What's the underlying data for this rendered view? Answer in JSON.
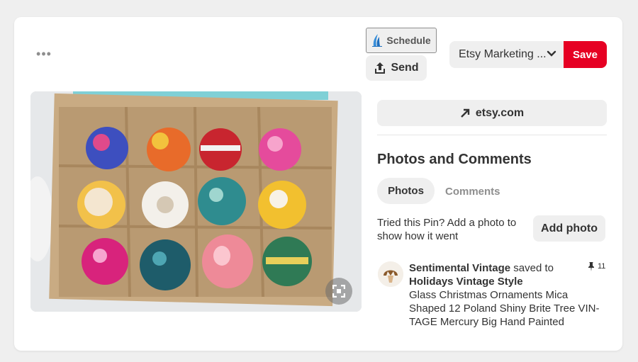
{
  "toolbar": {
    "more_icon": "more-horizontal-icon",
    "schedule_label": "Schedule",
    "send_label": "Send",
    "board_label": "Etsy Marketing ...",
    "save_label": "Save",
    "save_color": "#e60023"
  },
  "pin": {
    "image_subject": "Box of 12 vintage glass Christmas ornaments",
    "source_label": "etsy.com"
  },
  "photos_section": {
    "title": "Photos and Comments",
    "tabs": [
      {
        "label": "Photos",
        "active": true
      },
      {
        "label": "Comments",
        "active": false
      }
    ],
    "prompt": "Tried this Pin? Add a photo to show how it went",
    "add_photo_label": "Add photo"
  },
  "activity": {
    "user": "Sentimental Vintage",
    "action": "saved to",
    "board": "Holidays Vintage Style",
    "description": "Glass Christmas Ornaments Mica Shaped 12 Poland Shiny Brite Tree VIN-TAGE Mercury Big Hand Painted",
    "pin_count": "11"
  }
}
